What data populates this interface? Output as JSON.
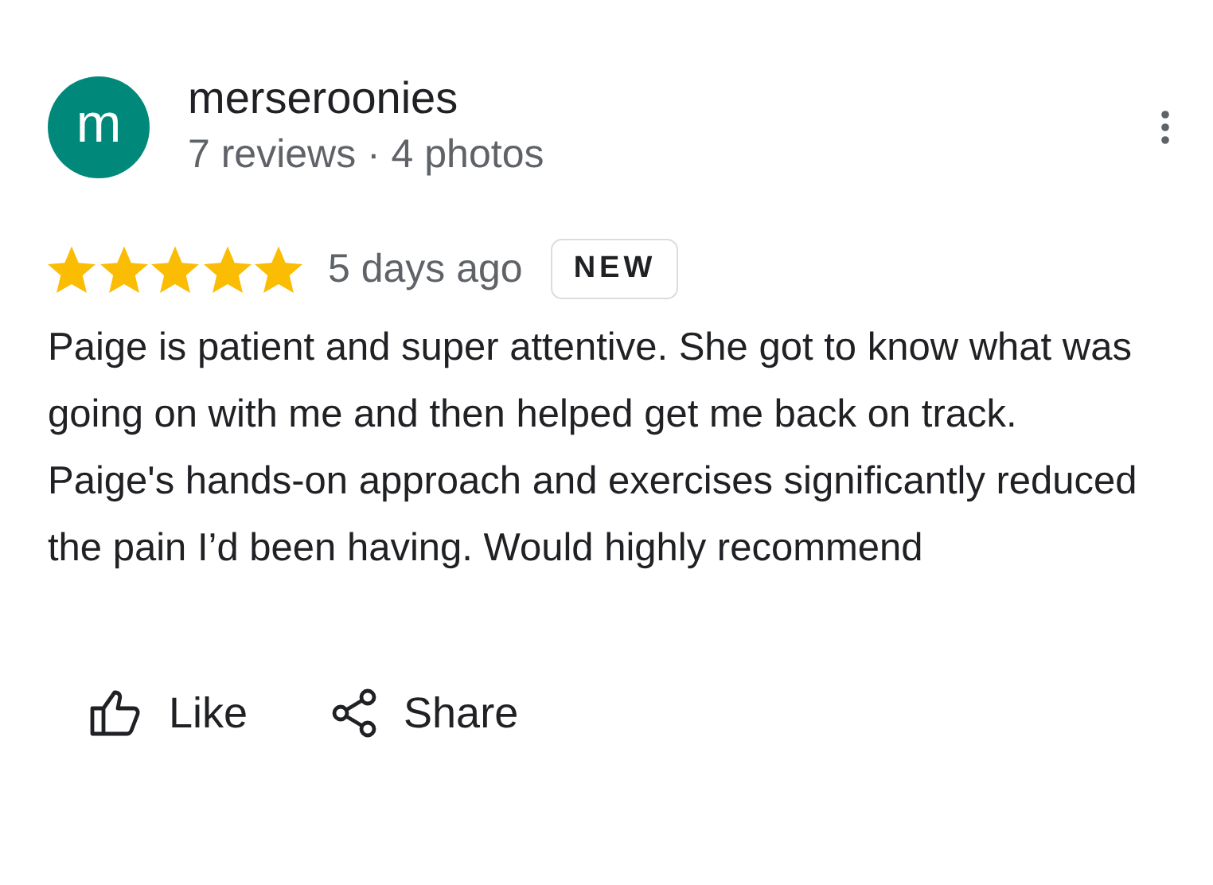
{
  "review": {
    "avatar_letter": "m",
    "author": "merseroonies",
    "meta": "7 reviews · 4 photos",
    "stars": 5,
    "time": "5 days ago",
    "badge": "NEW",
    "text": "Paige is patient and super attentive. She got to know what was going on with me and then helped get me back on track. Paige's hands-on approach and exercises significantly reduced the pain I’d been having. Would highly recommend"
  },
  "actions": [
    {
      "kind": "like",
      "label": "Like"
    },
    {
      "kind": "share",
      "label": "Share"
    }
  ]
}
